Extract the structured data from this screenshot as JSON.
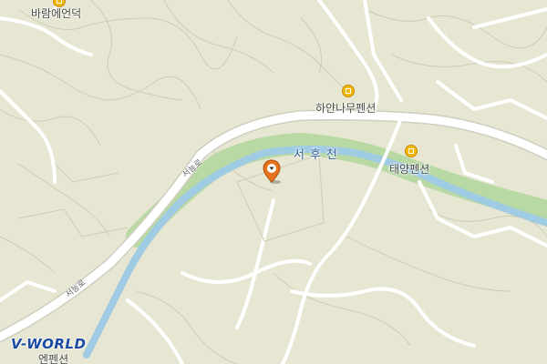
{
  "map": {
    "provider_logo": "V-WORLD",
    "colors": {
      "land": "#e6e6d2",
      "road": "#ffffff",
      "road_casing": "#cfcfbf",
      "contour": "#cdcdb5",
      "river": "#9fcbe3",
      "riverbank": "#b8d9a4",
      "poi": "#f2b705",
      "marker": "#e8711c"
    },
    "pois": [
      {
        "name": "바람에언덕",
        "icon": "pension-icon"
      },
      {
        "name": "하얀나무펜션",
        "icon": "pension-icon"
      },
      {
        "name": "태양펜션",
        "icon": "pension-icon"
      },
      {
        "name": "엔펜션",
        "icon": "pension-icon"
      }
    ],
    "river_name": "서후천",
    "road_labels": [
      "서능로",
      "서능로"
    ],
    "marker": {
      "icon": "location-pin-icon"
    }
  }
}
